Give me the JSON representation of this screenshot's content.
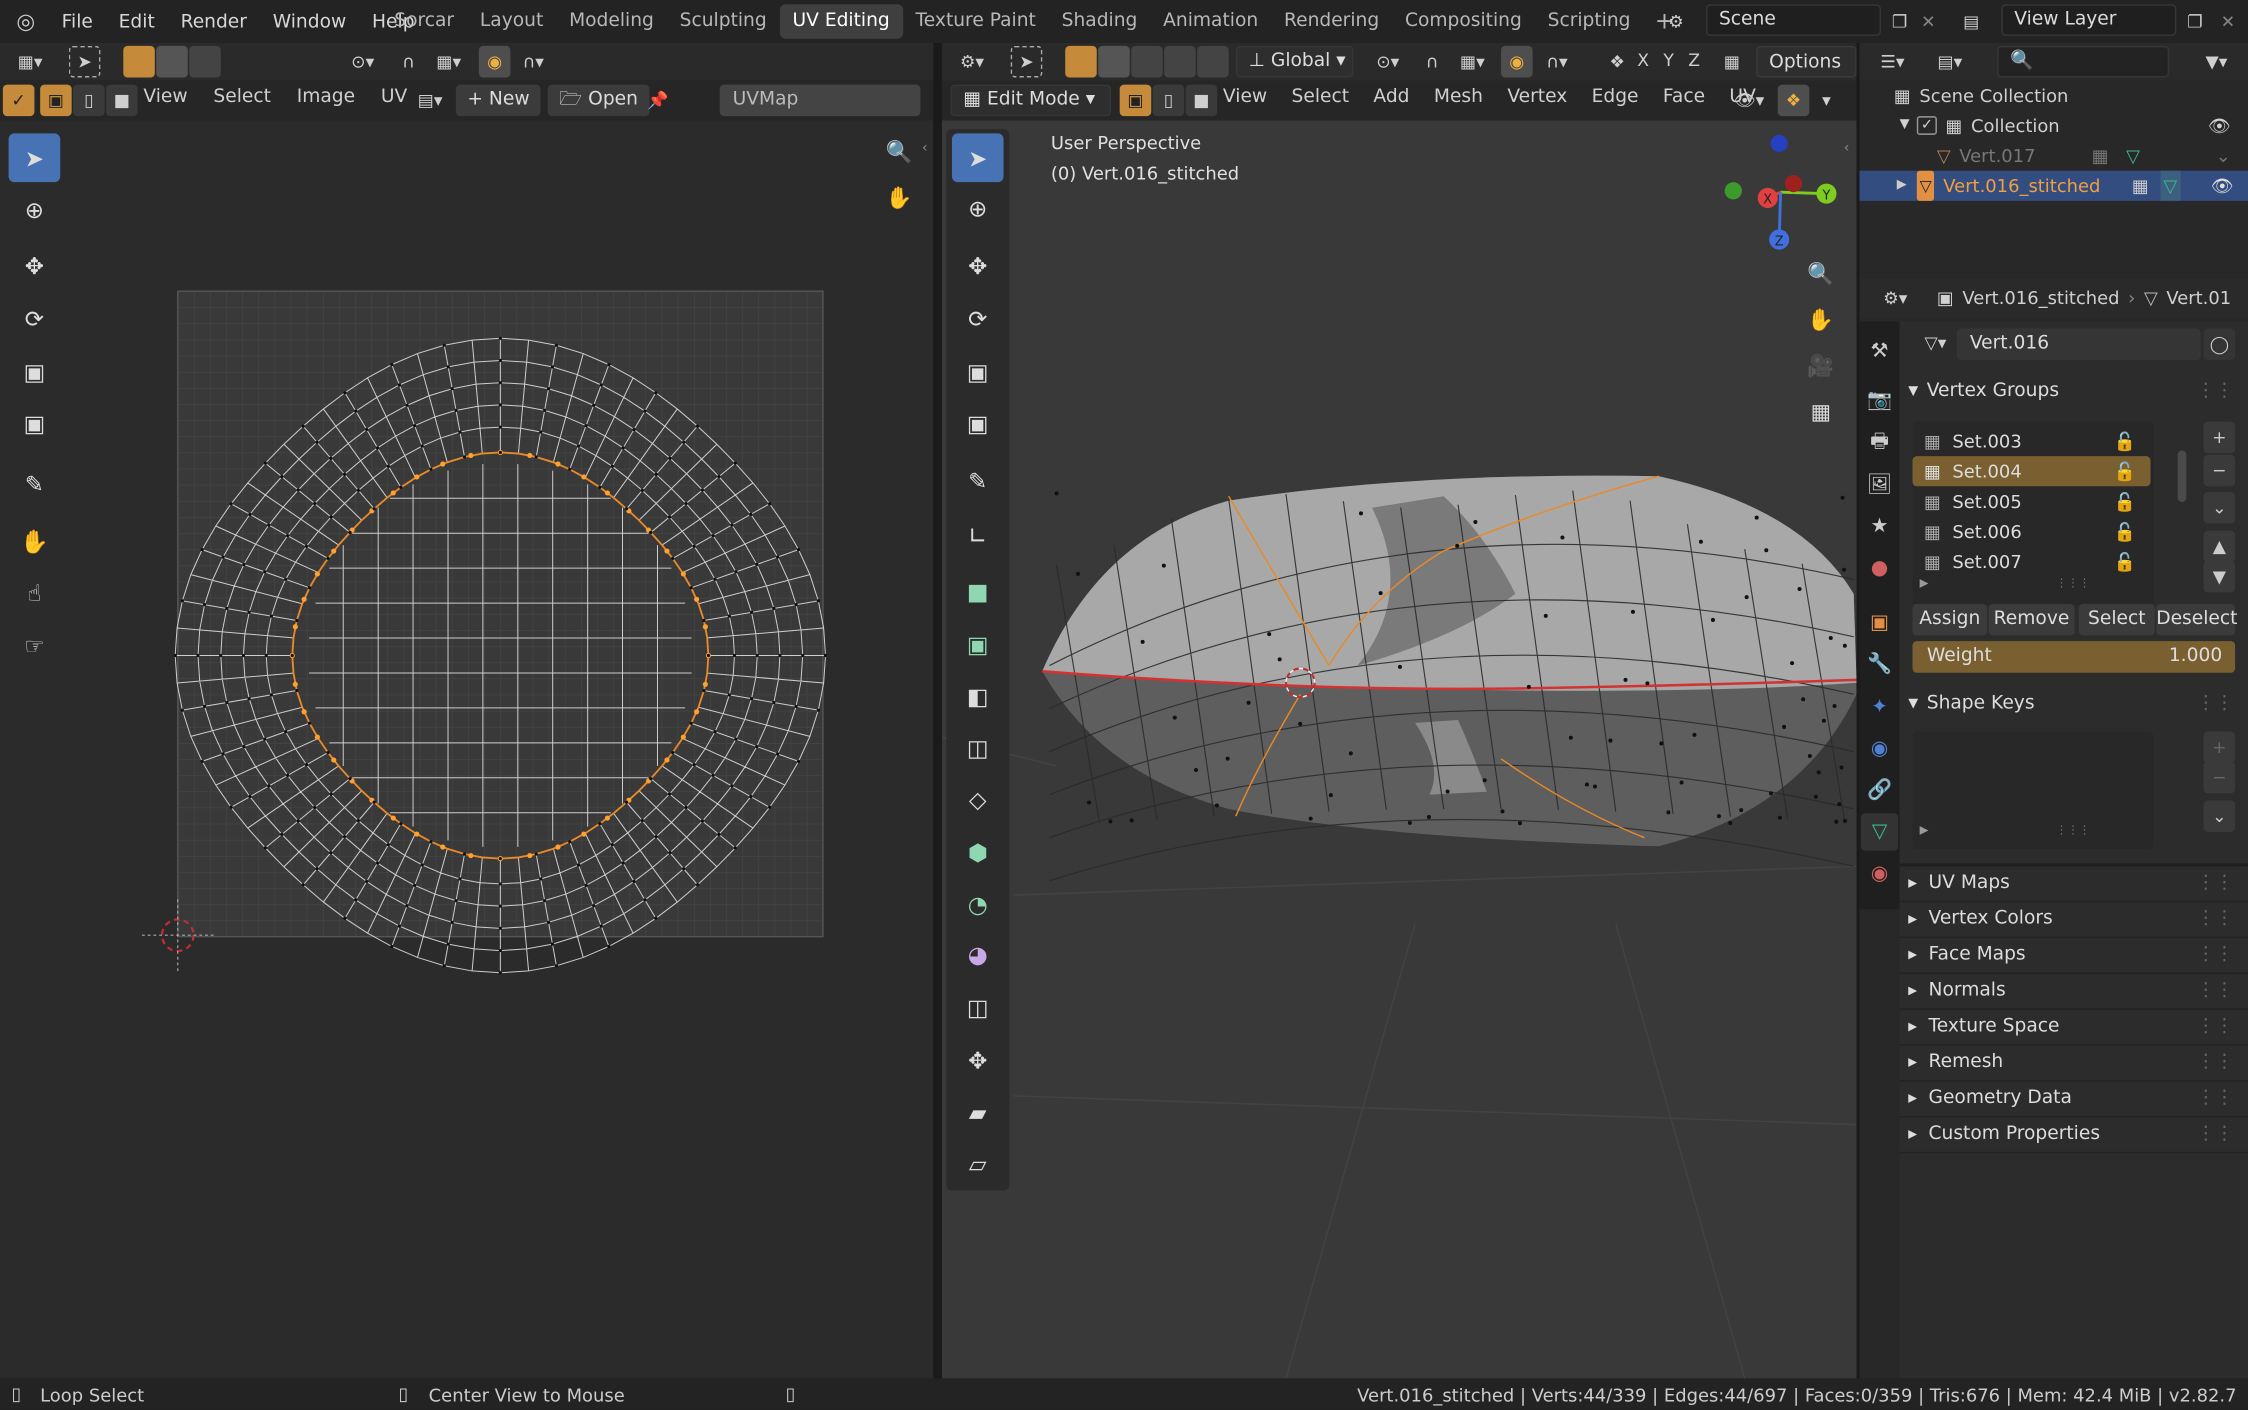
{
  "menu": [
    "File",
    "Edit",
    "Render",
    "Window",
    "Help"
  ],
  "workspace_tabs": [
    "Sorcar",
    "Layout",
    "Modeling",
    "Sculpting",
    "UV Editing",
    "Texture Paint",
    "Shading",
    "Animation",
    "Rendering",
    "Compositing",
    "Scripting"
  ],
  "active_tab": "UV Editing",
  "scene": {
    "label": "Scene",
    "view_layer": "View Layer"
  },
  "uv_editor": {
    "menus": [
      "View",
      "Select",
      "Image",
      "UV"
    ],
    "new_label": "New",
    "open_label": "Open",
    "uvmap": "UVMap"
  },
  "viewport": {
    "mode": "Edit Mode",
    "menus": [
      "View",
      "Select",
      "Add",
      "Mesh",
      "Vertex",
      "Edge",
      "Face",
      "UV"
    ],
    "orientation": "Global",
    "options_label": "Options",
    "axes": [
      "X",
      "Y",
      "Z"
    ],
    "overlay_line1": "User Perspective",
    "overlay_line2": "(0) Vert.016_stitched",
    "gizmo": {
      "x": "X",
      "y": "Y",
      "z": "Z"
    }
  },
  "outliner": {
    "scene_collection": "Scene Collection",
    "collection": "Collection",
    "items": [
      {
        "label": "Vert.017",
        "active": false
      },
      {
        "label": "Vert.016_stitched",
        "active": true
      }
    ]
  },
  "properties": {
    "breadcrumb_object": "Vert.016_stitched",
    "breadcrumb_mesh": "Vert.01",
    "mesh_name": "Vert.016",
    "vertex_groups_title": "Vertex Groups",
    "vertex_groups": [
      "Set.003",
      "Set.004",
      "Set.005",
      "Set.006",
      "Set.007"
    ],
    "active_group": "Set.004",
    "buttons": {
      "assign": "Assign",
      "remove": "Remove",
      "select": "Select",
      "deselect": "Deselect"
    },
    "weight_label": "Weight",
    "weight_value": "1.000",
    "shape_keys_title": "Shape Keys",
    "collapsed_panels": [
      "UV Maps",
      "Vertex Colors",
      "Face Maps",
      "Normals",
      "Texture Space",
      "Remesh",
      "Geometry Data",
      "Custom Properties"
    ]
  },
  "status": {
    "left1": "Loop Select",
    "left2": "Center View to Mouse",
    "right": "Vert.016_stitched | Verts:44/339 | Edges:44/697 | Faces:0/359 | Tris:676 | Mem: 42.4 MiB | v2.82.7"
  },
  "colors": {
    "accent": "#4772b3",
    "selection": "#e8892a",
    "active_group": "#7a6030",
    "edge_red": "#d43232",
    "mesh_light": "#a5a5a5"
  }
}
